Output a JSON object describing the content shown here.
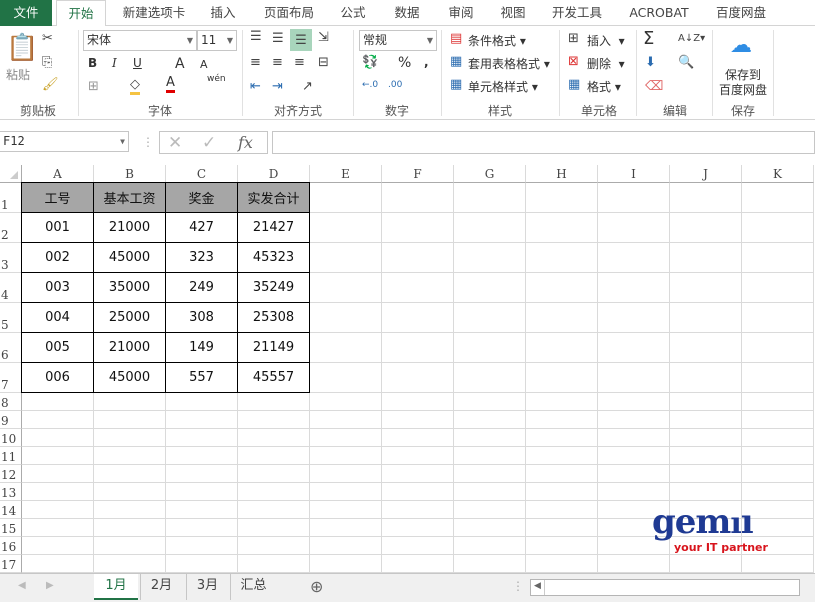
{
  "ribbon_tabs": [
    "文件",
    "开始",
    "新建选项卡",
    "插入",
    "页面布局",
    "公式",
    "数据",
    "审阅",
    "视图",
    "开发工具",
    "ACROBAT",
    "百度网盘"
  ],
  "active_tab": "开始",
  "clipboard": {
    "paste": "粘贴",
    "label": "剪贴板"
  },
  "font": {
    "name": "宋体",
    "size": "11",
    "bold": "B",
    "italic": "I",
    "underline": "U",
    "grow": "A",
    "shrink": "A",
    "phonetic": "wén",
    "label": "字体"
  },
  "alignment": {
    "label": "对齐方式"
  },
  "number": {
    "format": "常规",
    "percent": "%",
    "comma": ",",
    "label": "数字"
  },
  "styles": {
    "conditional": "条件格式",
    "table": "套用表格格式",
    "cell": "单元格样式",
    "label": "样式"
  },
  "cells": {
    "insert": "插入",
    "delete": "删除",
    "format": "格式",
    "label": "单元格"
  },
  "editing": {
    "label": "编辑",
    "sum": "Σ"
  },
  "save": {
    "line1": "保存到",
    "line2": "百度网盘",
    "label": "保存"
  },
  "formula_bar": {
    "name_box": "F12",
    "fx": "fx",
    "value": ""
  },
  "columns": [
    "A",
    "B",
    "C",
    "D",
    "E",
    "F",
    "G",
    "H",
    "I",
    "J",
    "K"
  ],
  "rows": [
    "1",
    "2",
    "3",
    "4",
    "5",
    "6",
    "7",
    "8",
    "9",
    "10",
    "11",
    "12",
    "13",
    "14",
    "15",
    "16",
    "17"
  ],
  "table": {
    "headers": [
      "工号",
      "基本工资",
      "奖金",
      "实发合计"
    ],
    "rows": [
      [
        "001",
        "21000",
        "427",
        "21427"
      ],
      [
        "002",
        "45000",
        "323",
        "45323"
      ],
      [
        "003",
        "35000",
        "249",
        "35249"
      ],
      [
        "004",
        "25000",
        "308",
        "25308"
      ],
      [
        "005",
        "21000",
        "149",
        "21149"
      ],
      [
        "006",
        "45000",
        "557",
        "45557"
      ]
    ]
  },
  "header_fill": "#a6a6a6",
  "watermark": {
    "logo": "gemini",
    "tagline": "your IT partner"
  },
  "sheet_tabs": [
    "1月",
    "2月",
    "3月",
    "汇总"
  ],
  "active_sheet": "1月"
}
